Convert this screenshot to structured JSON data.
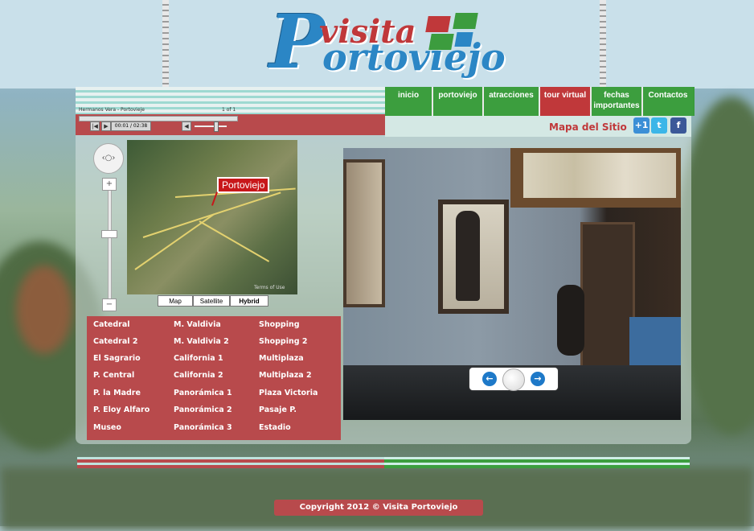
{
  "logo": {
    "big_letter": "P",
    "word_top": "visita",
    "word_bottom": "ortoviejo"
  },
  "player": {
    "track_title": "Hermanos Vera - Portovieje",
    "track_count": "1 of 1",
    "time": "00:01 / 02:38"
  },
  "nav": {
    "items": [
      {
        "label": "inicio"
      },
      {
        "label": "portoviejo"
      },
      {
        "label": "atracciones"
      },
      {
        "label": "tour virtual",
        "active": true
      },
      {
        "label": "fechas importantes"
      },
      {
        "label": "Contactos"
      }
    ],
    "sitemap": "Mapa del Sitio",
    "social": [
      "+1",
      "t",
      "f"
    ]
  },
  "map": {
    "marker": "Portoviejo",
    "types": [
      "Map",
      "Satellite",
      "Hybrid"
    ],
    "selected_type": "Hybrid",
    "terms": "Terms of Use"
  },
  "locations": {
    "col1": [
      "Catedral",
      "Catedral 2",
      "El Sagrario",
      "P. Central",
      "P. la Madre",
      "P. Eloy Alfaro",
      "Museo"
    ],
    "col2": [
      "M. Valdivia",
      "M. Valdivia 2",
      "California 1",
      "California 2",
      "Panorámica 1",
      "Panorámica 2",
      "Panorámica 3"
    ],
    "col3": [
      "Shopping",
      "Shopping 2",
      "Multiplaza",
      "Multiplaza 2",
      "Plaza Victoria",
      "Pasaje P.",
      "Estadio"
    ]
  },
  "footer": {
    "copyright": "Copyright 2012 © Visita Portoviejo"
  },
  "colors": {
    "red": "#b84a4c",
    "green": "#3c9e3e",
    "blue": "#2b86c5"
  }
}
